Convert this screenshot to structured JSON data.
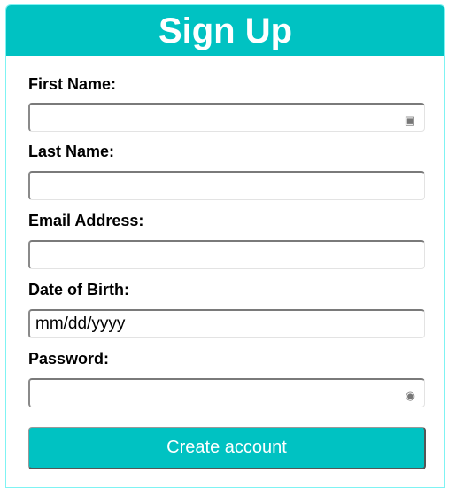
{
  "title": "Sign Up",
  "fields": [
    {
      "label": "First Name:",
      "value": "",
      "icon": "contact-card-icon"
    },
    {
      "label": "Last Name:",
      "value": ""
    },
    {
      "label": "Email Address:",
      "value": ""
    },
    {
      "label": "Date of Birth:",
      "value": "mm/dd/yyyy"
    },
    {
      "label": "Password:",
      "value": "",
      "icon": "password-key-icon"
    }
  ],
  "submit_label": "Create account",
  "colors": {
    "accent": "#00c2c2"
  }
}
